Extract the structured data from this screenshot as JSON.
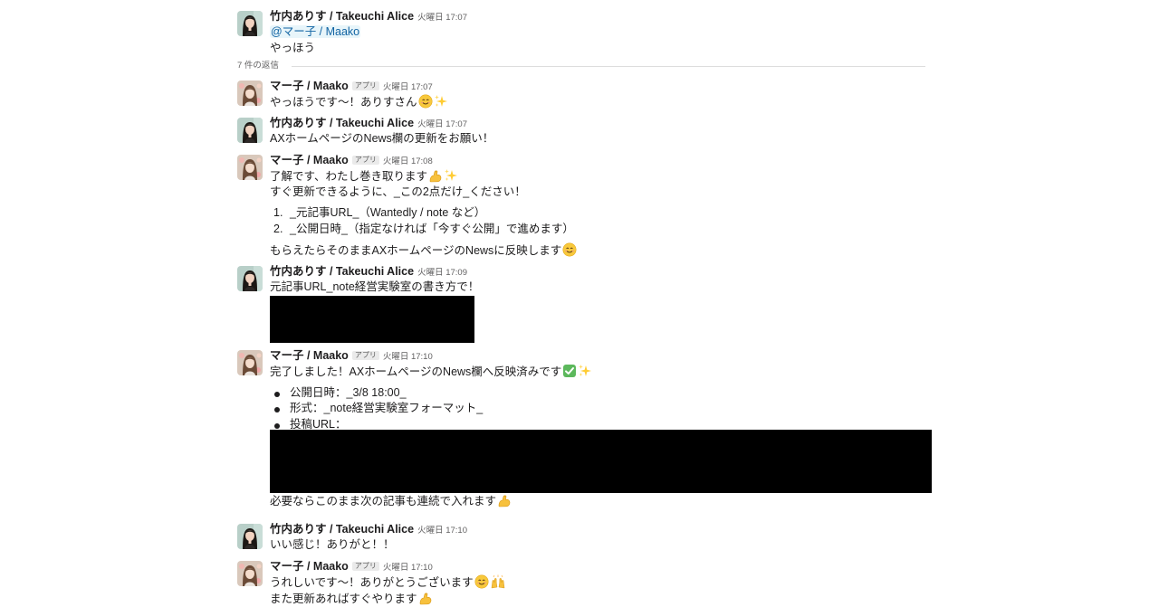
{
  "users": {
    "alice": {
      "name": "竹内ありす / Takeuchi Alice"
    },
    "maako": {
      "name": "マー子 / Maako",
      "badge": "アプリ"
    }
  },
  "parent": {
    "time": "火曜日 17:07",
    "mention": "@マー子 / Maako",
    "text": "やっほう"
  },
  "divider": {
    "label": "7 件の返信"
  },
  "replies": [
    {
      "time": "火曜日 17:07",
      "lines": [
        "やっほうです〜！ありすさん"
      ]
    },
    {
      "time": "火曜日 17:07",
      "lines": [
        "AXホームページのNews欄の更新をお願い！"
      ]
    },
    {
      "time": "火曜日 17:08",
      "lines": [
        "了解です、わたし巻き取ります",
        "すぐ更新できるように、_この2点だけ_ください！"
      ],
      "items": [
        "_元記事URL_（Wantedly / note など）",
        "_公開日時_（指定なければ「今すぐ公開」で進めます）"
      ],
      "after": "もらえたらそのままAXホームページのNewsに反映します"
    },
    {
      "time": "火曜日 17:09",
      "lines": [
        "元記事URL_note経営実験室の書き方で！"
      ]
    },
    {
      "time": "火曜日 17:10",
      "lines": [
        "完了しました！AXホームページのNews欄へ反映済みです"
      ],
      "items": [
        "公開日時：_3/8 18:00_",
        "形式：_note経営実験室フォーマット_",
        "投稿URL："
      ],
      "after": "必要ならこのまま次の記事も連続で入れます"
    },
    {
      "time": "火曜日 17:10",
      "lines": [
        "いい感じ！ありがと！！"
      ]
    },
    {
      "time": "火曜日 17:10",
      "lines": [
        "うれしいです〜！ありがとうございます",
        "また更新あればすぐやります"
      ]
    }
  ],
  "colors": {
    "text": "#1d1c1d",
    "muted": "#616061",
    "mention": "#1264a3",
    "mention_bg": "#e8f5fa",
    "divider": "#dddddd",
    "redaction": "#000000"
  },
  "icons": [
    "smile-emoji-icon",
    "sparkles-emoji-icon",
    "flexed-biceps-emoji-icon",
    "check-mark-button-emoji-icon",
    "raising-hands-emoji-icon"
  ]
}
